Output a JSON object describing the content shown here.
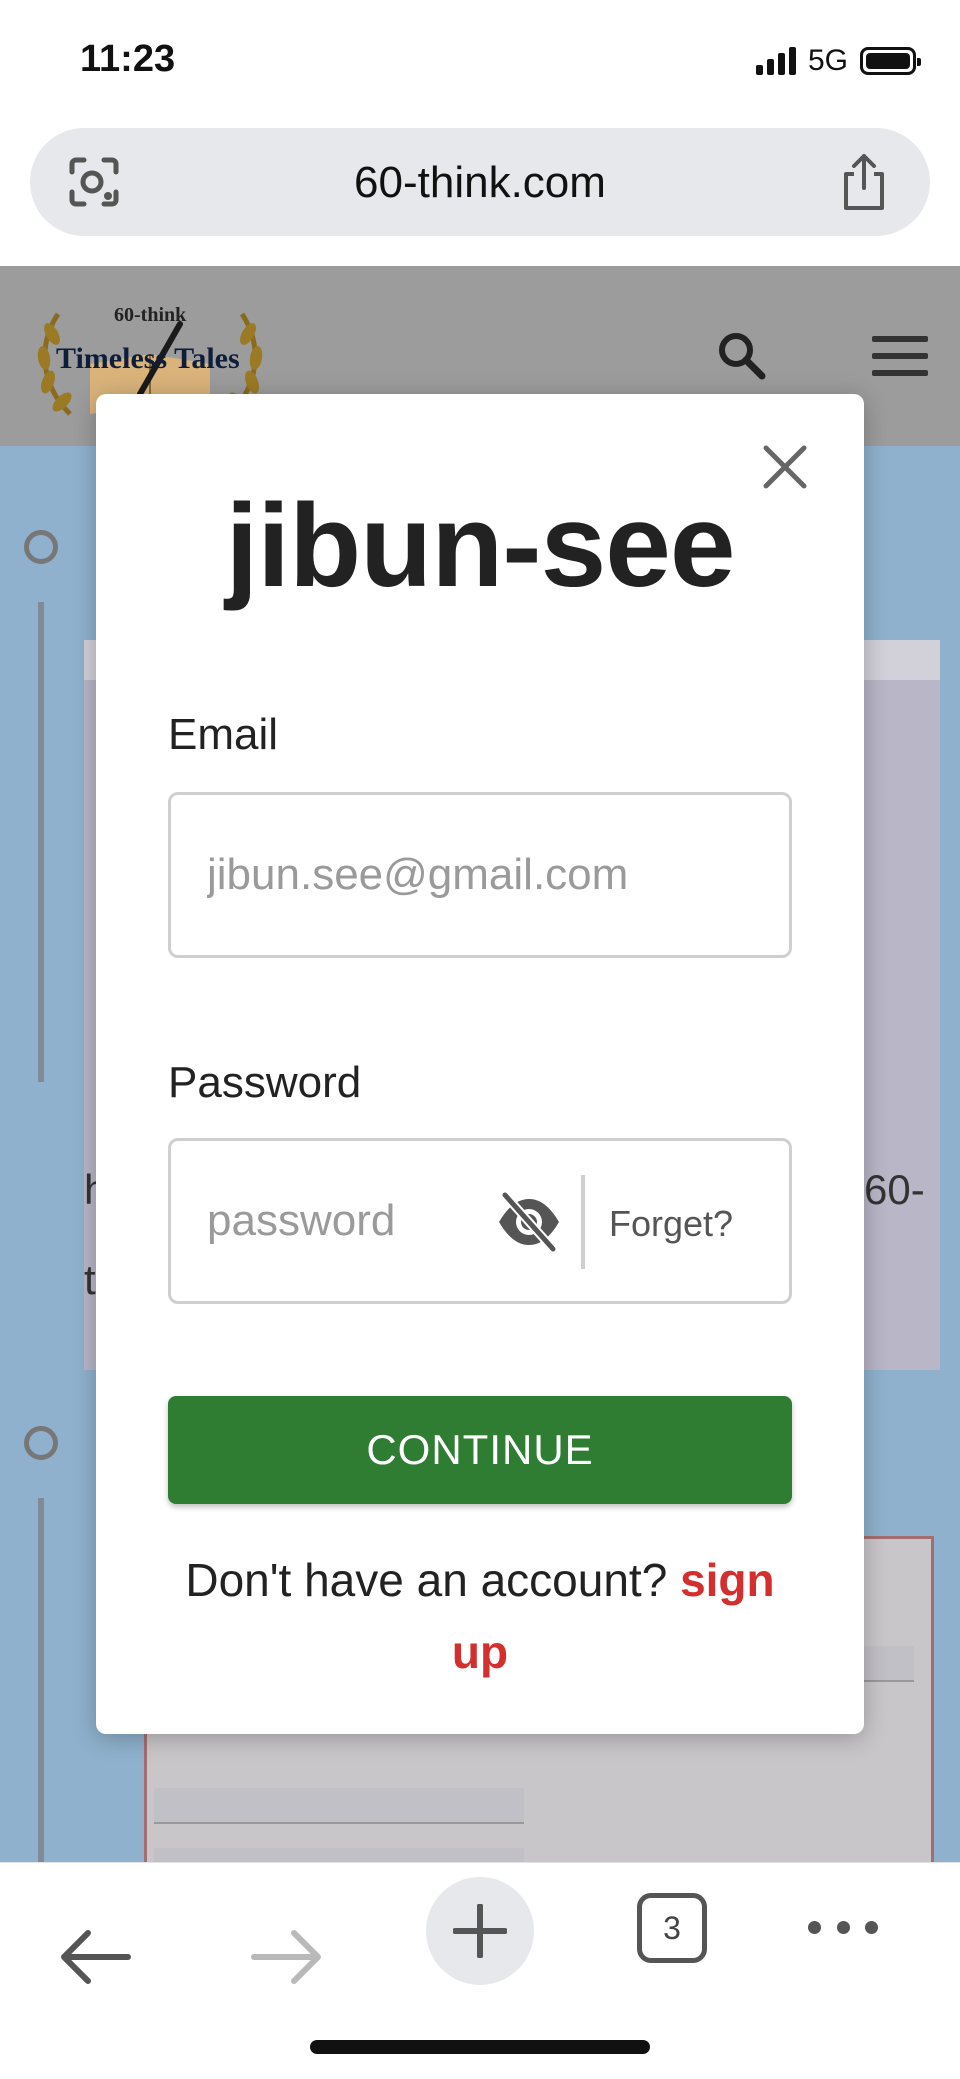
{
  "status_bar": {
    "time": "11:23",
    "network": "5G",
    "icons": [
      "signal-icon",
      "battery-icon"
    ]
  },
  "browser": {
    "url": "60-think.com",
    "icons": [
      "lens-icon",
      "share-icon"
    ]
  },
  "background_page": {
    "logo": {
      "small_text": "60-think",
      "main_text": "Timeless Tales"
    },
    "icons": [
      "search-icon",
      "menu-icon"
    ],
    "visible_text_fragments": [
      "60-"
    ]
  },
  "modal": {
    "title": "jibun-see",
    "email": {
      "label": "Email",
      "placeholder": "jibun.see@gmail.com",
      "value": ""
    },
    "password": {
      "label": "Password",
      "placeholder": "password",
      "value": "",
      "forget_label": "Forget?"
    },
    "continue_label": "CONTINUE",
    "signup_prompt": "Don't have an account?",
    "signup_link": "sign up",
    "colors": {
      "primary_button": "#2e7d32",
      "signup_link": "#d32f2f"
    }
  },
  "toolbar": {
    "tab_count": "3",
    "icons": [
      "back-arrow-icon",
      "forward-arrow-icon",
      "plus-icon",
      "tabs-icon",
      "more-icon"
    ]
  }
}
